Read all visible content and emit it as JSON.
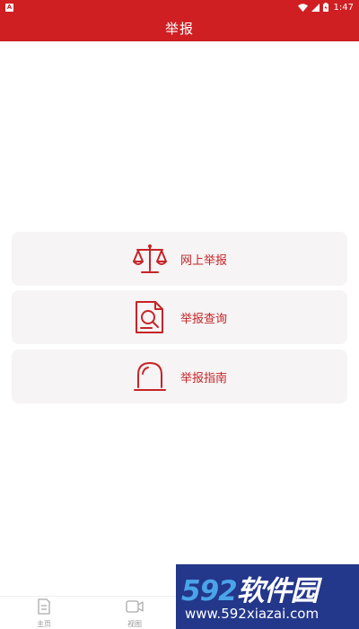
{
  "status_bar": {
    "time": "1:47",
    "colors": {
      "background": "#cf1f22"
    }
  },
  "header": {
    "title": "举报"
  },
  "menu": [
    {
      "label": "网上举报",
      "icon": "scales-icon"
    },
    {
      "label": "举报查询",
      "icon": "document-search-icon"
    },
    {
      "label": "举报指南",
      "icon": "alarm-light-icon"
    }
  ],
  "bottom_nav": {
    "items": [
      {
        "label": "主页",
        "icon": "document-icon"
      },
      {
        "label": "视图",
        "icon": "video-icon"
      }
    ]
  },
  "watermark": {
    "logo_digits": "592",
    "logo_text": "软件园",
    "url": "www.592xiazai.com"
  },
  "colors": {
    "accent": "#cf1f22",
    "card_background": "#f6f4f4",
    "label_red": "#c62428"
  }
}
